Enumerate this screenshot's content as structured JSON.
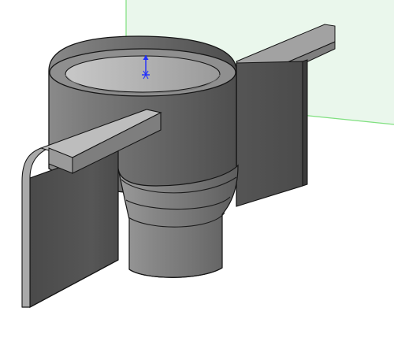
{
  "viewport": {
    "background_color": "#ffffff",
    "reference_plane_color": "#eaf7ec",
    "reference_plane_edge_color": "#7fe07f"
  },
  "model": {
    "cup_top_color": "#8a8a8a",
    "cup_side_color": "#7a7a7a",
    "flange_dark_color": "#4a4a4a",
    "flange_mid_color": "#5e5e5e",
    "flange_light_color": "#9a9a9a",
    "edge_color": "#151515"
  },
  "origin_marker": {
    "icon": "coordinate-origin-icon",
    "color": "#1f2dff"
  }
}
